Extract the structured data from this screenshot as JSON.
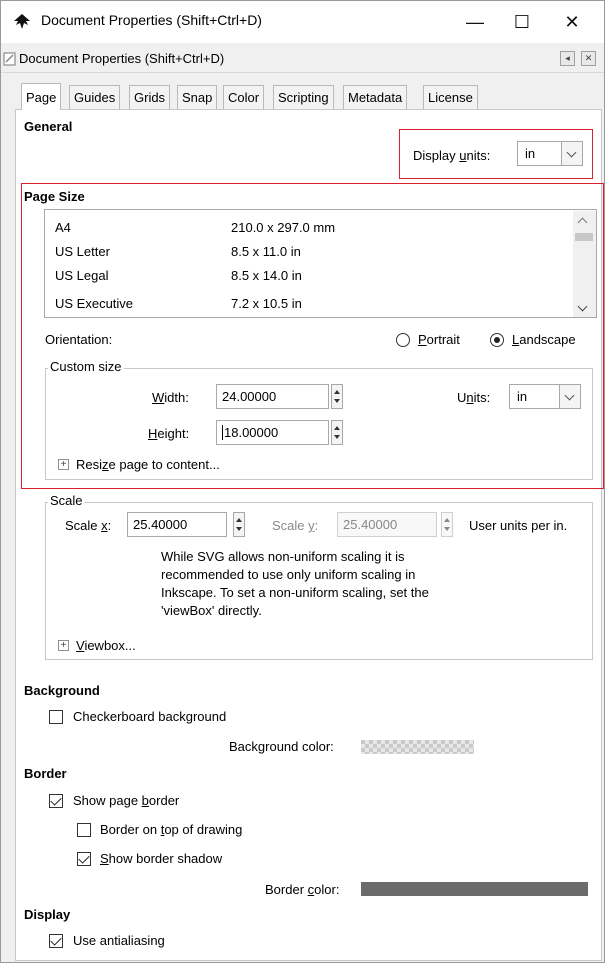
{
  "window": {
    "title": "Document Properties (Shift+Ctrl+D)",
    "minimize": "—",
    "maximize": "☐",
    "close": "✕"
  },
  "dock": {
    "title": "Document Properties (Shift+Ctrl+D)",
    "iconify": "◂",
    "close": "✕"
  },
  "tabs": [
    "Page",
    "Guides",
    "Grids",
    "Snap",
    "Color",
    "Scripting",
    "Metadata",
    "License"
  ],
  "general": {
    "heading": "General",
    "display_units_label_pre": "Display ",
    "display_units_label_u": "u",
    "display_units_label_post": "nits:",
    "display_units_value": "in"
  },
  "page_size": {
    "heading": "Page Size",
    "rows": [
      {
        "name": "A4",
        "dims": "210.0 x 297.0 mm"
      },
      {
        "name": "US Letter",
        "dims": "8.5 x 11.0 in"
      },
      {
        "name": "US Legal",
        "dims": "8.5 x 14.0 in"
      },
      {
        "name": "US Executive",
        "dims": "7.2 x 10.5 in"
      }
    ],
    "orientation_label": "Orientation:",
    "portrait_pre": "",
    "portrait_u": "P",
    "portrait_post": "ortrait",
    "landscape_pre": "",
    "landscape_u": "L",
    "landscape_post": "andscape",
    "orientation_selected": "landscape"
  },
  "custom_size": {
    "label": "Custom size",
    "width_u": "W",
    "width_post": "idth:",
    "width_value": "24.00000",
    "height_u": "H",
    "height_post": "eight:",
    "height_value": "18.00000",
    "units_pre": "U",
    "units_u": "n",
    "units_post": "its:",
    "units_value": "in",
    "resize_pre": "Resi",
    "resize_u": "z",
    "resize_post": "e page to content..."
  },
  "scale": {
    "label": "Scale",
    "scale_x_pre": "Scale ",
    "scale_x_u": "x",
    "scale_x_post": ":",
    "scale_x_value": "25.40000",
    "scale_y_pre": "Scale ",
    "scale_y_u": "y",
    "scale_y_post": ":",
    "scale_y_value": "25.40000",
    "user_units": "User units per in.",
    "note_lines": [
      "While SVG allows non-uniform scaling it is",
      "recommended to use only uniform scaling in",
      "Inkscape. To set a non-uniform scaling, set the",
      "'viewBox' directly."
    ],
    "viewbox_u": "V",
    "viewbox_post": "iewbox..."
  },
  "background": {
    "heading": "Background",
    "checkerboard_label": "Checkerboard background",
    "checkerboard_checked": false,
    "color_label": "Background color:"
  },
  "border": {
    "heading": "Border",
    "show_pre": "Show page ",
    "show_u": "b",
    "show_post": "order",
    "show_checked": true,
    "ontop_pre": "Border on ",
    "ontop_u": "t",
    "ontop_post": "op of drawing",
    "ontop_checked": false,
    "shadow_pre": "",
    "shadow_u": "S",
    "shadow_post": "how border shadow",
    "shadow_checked": true,
    "color_pre": "Border ",
    "color_u": "c",
    "color_post": "olor:",
    "color_hex": "#6b6b6b"
  },
  "display": {
    "heading": "Display",
    "antialias_label": "Use antialiasing",
    "antialias_checked": true
  },
  "colors": {
    "highlight_red": "#d8202f"
  }
}
